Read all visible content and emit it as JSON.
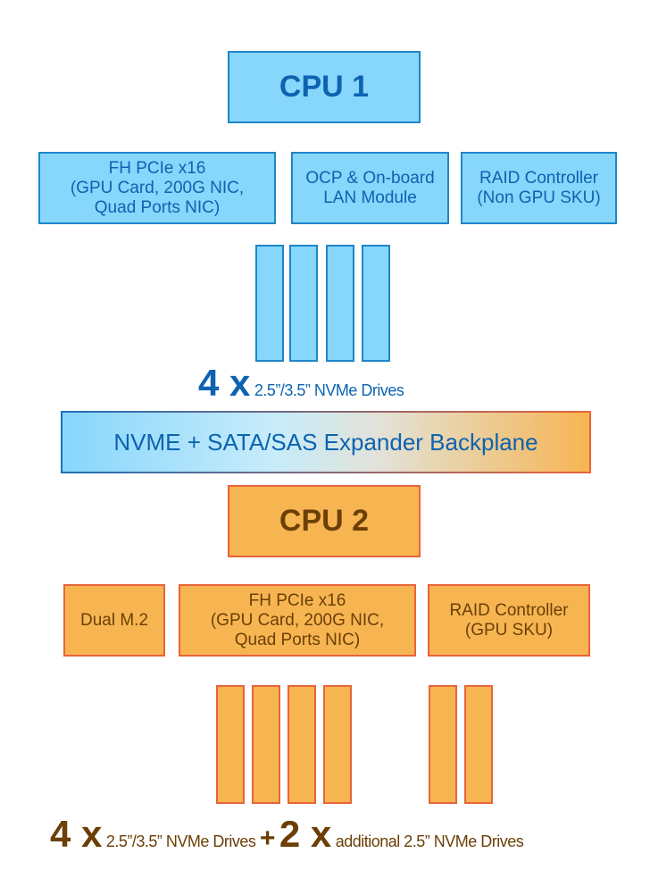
{
  "cpu1": {
    "label": "CPU 1"
  },
  "cpu1_slots": [
    "FH PCIe x16\n(GPU Card, 200G NIC,\nQuad Ports NIC)",
    "OCP & On-board\nLAN Module",
    "RAID Controller\n(Non GPU SKU)"
  ],
  "cpu1_drives": {
    "count": "4 x",
    "desc": "2.5”/3.5” NVMe Drives"
  },
  "backplane": {
    "label": "NVME + SATA/SAS Expander Backplane"
  },
  "cpu2": {
    "label": "CPU 2"
  },
  "cpu2_slots": [
    "Dual M.2",
    "FH PCIe x16\n(GPU Card, 200G NIC,\nQuad Ports NIC)",
    "RAID Controller\n(GPU SKU)"
  ],
  "cpu2_drives": {
    "count": "4 x",
    "desc": "2.5”/3.5” NVMe Drives",
    "plus": "+",
    "count2": "2 x",
    "desc2": "additional 2.5” NVMe Drives"
  },
  "colors": {
    "blue_fill": "#87d6fb",
    "blue_border": "#1f86c8",
    "blue_text": "#0d63b0",
    "orange_fill": "#f7b552",
    "orange_border": "#e8643a",
    "orange_text": "#6b3f06"
  }
}
